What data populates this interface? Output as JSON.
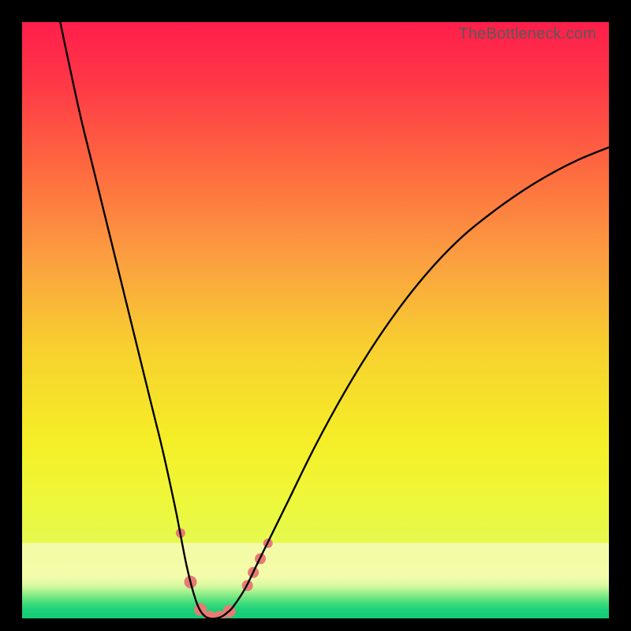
{
  "watermark": "TheBottleneck.com",
  "chart_data": {
    "type": "line",
    "title": "",
    "xlabel": "",
    "ylabel": "",
    "xlim": [
      0,
      100
    ],
    "ylim": [
      0,
      100
    ],
    "gradient_stops": [
      {
        "offset": 0.0,
        "color": "#ff1e4b"
      },
      {
        "offset": 0.1,
        "color": "#ff3747"
      },
      {
        "offset": 0.25,
        "color": "#fe6b3f"
      },
      {
        "offset": 0.4,
        "color": "#fba040"
      },
      {
        "offset": 0.55,
        "color": "#f7d12f"
      },
      {
        "offset": 0.7,
        "color": "#f5ee27"
      },
      {
        "offset": 0.8,
        "color": "#eef73a"
      },
      {
        "offset": 0.873,
        "color": "#e6f94f"
      },
      {
        "offset": 0.874,
        "color": "#f3fba9"
      },
      {
        "offset": 0.9,
        "color": "#f3fba6"
      },
      {
        "offset": 0.93,
        "color": "#f4fcab"
      },
      {
        "offset": 0.945,
        "color": "#d8f9a2"
      },
      {
        "offset": 0.955,
        "color": "#a6f18e"
      },
      {
        "offset": 0.965,
        "color": "#6fe681"
      },
      {
        "offset": 0.975,
        "color": "#3ddb7c"
      },
      {
        "offset": 0.985,
        "color": "#1dd178"
      },
      {
        "offset": 1.0,
        "color": "#12cd77"
      }
    ],
    "series": [
      {
        "name": "bottleneck-curve",
        "x": [
          6.5,
          8,
          10,
          12,
          14,
          16,
          18,
          20,
          22,
          24,
          26,
          27,
          28,
          29,
          30,
          31,
          32,
          33,
          34,
          35,
          36,
          38,
          40,
          42,
          45,
          50,
          55,
          60,
          65,
          70,
          75,
          80,
          85,
          90,
          95,
          100
        ],
        "y": [
          100,
          93,
          84,
          76,
          68,
          60,
          52,
          44,
          36,
          28,
          19,
          14,
          9,
          5,
          2,
          0.5,
          0,
          0,
          0.3,
          1,
          2,
          5,
          9,
          13,
          19,
          29,
          38,
          46,
          53,
          59,
          64,
          68,
          71.5,
          74.5,
          77,
          79
        ]
      }
    ],
    "markers": {
      "name": "highlighted-points",
      "color": "#e77b73",
      "points": [
        {
          "x": 27.0,
          "y": 14.3,
          "r": 6
        },
        {
          "x": 28.7,
          "y": 6.1,
          "r": 8
        },
        {
          "x": 30.4,
          "y": 1.5,
          "r": 8
        },
        {
          "x": 32.0,
          "y": 0.2,
          "r": 8
        },
        {
          "x": 33.6,
          "y": 0.2,
          "r": 8
        },
        {
          "x": 35.3,
          "y": 1.2,
          "r": 8
        },
        {
          "x": 38.4,
          "y": 5.5,
          "r": 7
        },
        {
          "x": 39.4,
          "y": 7.7,
          "r": 7
        },
        {
          "x": 40.6,
          "y": 10.0,
          "r": 7
        },
        {
          "x": 41.9,
          "y": 12.6,
          "r": 6
        }
      ]
    }
  }
}
